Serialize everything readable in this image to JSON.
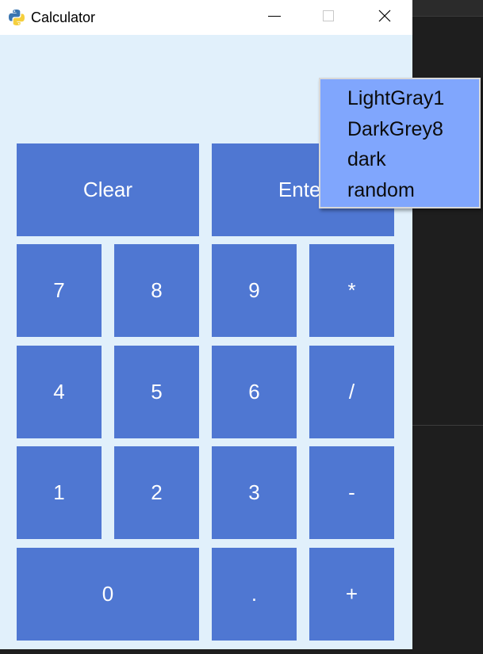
{
  "window": {
    "title": "Calculator",
    "app_icon": "python-logo-icon",
    "controls": {
      "minimize_icon": "minimize-icon",
      "maximize_icon": "maximize-icon",
      "close_icon": "close-icon"
    }
  },
  "colors": {
    "window_background": "#e1f0fb",
    "key_background": "#4f77d2",
    "key_text": "#ffffff",
    "popup_background": "#80a6fd",
    "popup_text": "#0b0b0b",
    "desktop_background": "#1e1e1e"
  },
  "keypad": {
    "clear": "Clear",
    "enter": "Enter",
    "seven": "7",
    "eight": "8",
    "nine": "9",
    "multiply": "*",
    "four": "4",
    "five": "5",
    "six": "6",
    "divide": "/",
    "one": "1",
    "two": "2",
    "three": "3",
    "subtract": "-",
    "zero": "0",
    "decimal": ".",
    "add": "+"
  },
  "popup_menu": {
    "items": [
      "LightGray1",
      "DarkGrey8",
      "dark",
      "random"
    ]
  }
}
